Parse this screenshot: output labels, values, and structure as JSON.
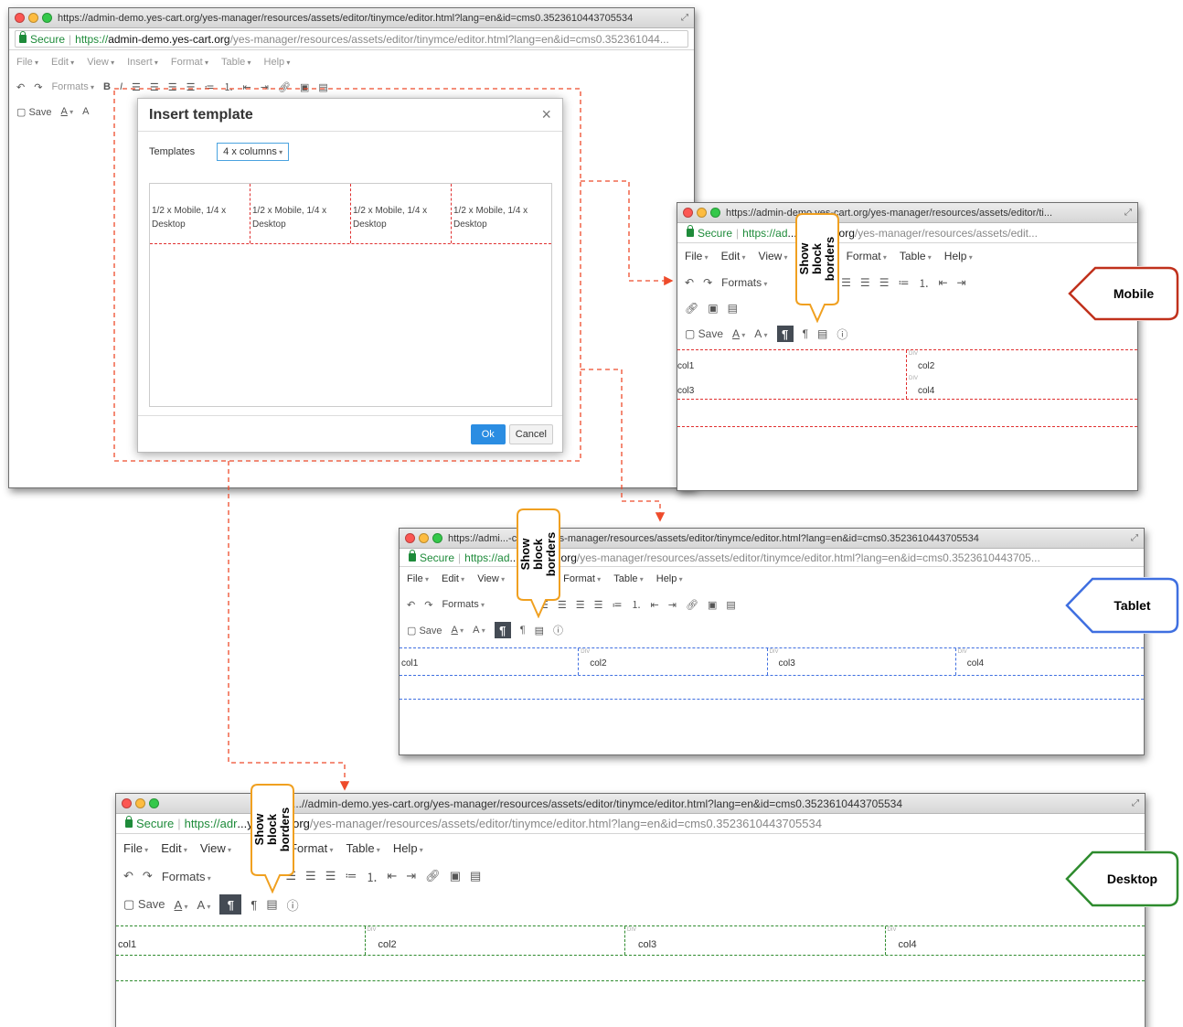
{
  "colors": {
    "dashed_arrow": "#ee4b2b",
    "mobile_outline": "#c0311c",
    "tablet_outline": "#3f6fe0",
    "desktop_outline": "#2e8b2e",
    "bubble_outline": "#f0a020",
    "ok_button": "#2b8de2"
  },
  "main_window": {
    "title_url": "https://admin-demo.yes-cart.org/yes-manager/resources/assets/editor/tinymce/editor.html?lang=en&id=cms0.3523610443705534",
    "secure": "Secure",
    "https": "https://",
    "domain": "admin-demo.yes-cart.org",
    "path": "/yes-manager/resources/assets/editor/tinymce/editor.html?lang=en&id=cms0.352361044...",
    "menu": [
      "File",
      "Edit",
      "View",
      "Insert",
      "Format",
      "Table",
      "Help"
    ],
    "formats": "Formats",
    "save": "Save"
  },
  "dialog": {
    "title": "Insert template",
    "templates_label": "Templates",
    "templates_value": "4 x columns",
    "preview_cells": [
      "1/2 x Mobile, 1/4 x Desktop",
      "1/2 x Mobile, 1/4 x Desktop",
      "1/2 x Mobile, 1/4 x Desktop",
      "1/2 x Mobile, 1/4 x Desktop"
    ],
    "ok": "Ok",
    "cancel": "Cancel"
  },
  "mobile_window": {
    "title_url": "https://admin-demo.yes-cart.org/yes-manager/resources/assets/editor/ti...",
    "secure": "Secure",
    "https": "https://ad",
    "domain": "...yes-cart.org",
    "path": "/yes-manager/resources/assets/edit...",
    "menu": [
      "File",
      "Edit",
      "View",
      "Format",
      "Table",
      "Help"
    ],
    "formats": "Formats",
    "save": "Save",
    "cells": [
      "col1",
      "col2",
      "col3",
      "col4"
    ],
    "callout": "Mobile",
    "bubble": "Show block borders"
  },
  "tablet_window": {
    "title_url": "https://admi...-cart.org/yes-manager/resources/assets/editor/tinymce/editor.html?lang=en&id=cms0.3523610443705534",
    "secure": "Secure",
    "https": "https://ad",
    "domain": "...yes-cart.org",
    "path": "/yes-manager/resources/assets/editor/tinymce/editor.html?lang=en&id=cms0.3523610443705...",
    "menu": [
      "File",
      "Edit",
      "View",
      "Format",
      "Table",
      "Help"
    ],
    "formats": "Formats",
    "save": "Save",
    "cells": [
      "col1",
      "col2",
      "col3",
      "col4"
    ],
    "callout": "Tablet",
    "bubble": "Show block borders"
  },
  "desktop_window": {
    "title_url": "...//admin-demo.yes-cart.org/yes-manager/resources/assets/editor/tinymce/editor.html?lang=en&id=cms0.3523610443705534",
    "secure": "Secure",
    "https": "https://adr",
    "domain": "...yes-cart.org",
    "path": "/yes-manager/resources/assets/editor/tinymce/editor.html?lang=en&id=cms0.3523610443705534",
    "menu": [
      "File",
      "Edit",
      "View",
      "Format",
      "Table",
      "Help"
    ],
    "formats": "Formats",
    "save": "Save",
    "cells": [
      "col1",
      "col2",
      "col3",
      "col4"
    ],
    "callout": "Desktop",
    "bubble": "Show block borders"
  }
}
